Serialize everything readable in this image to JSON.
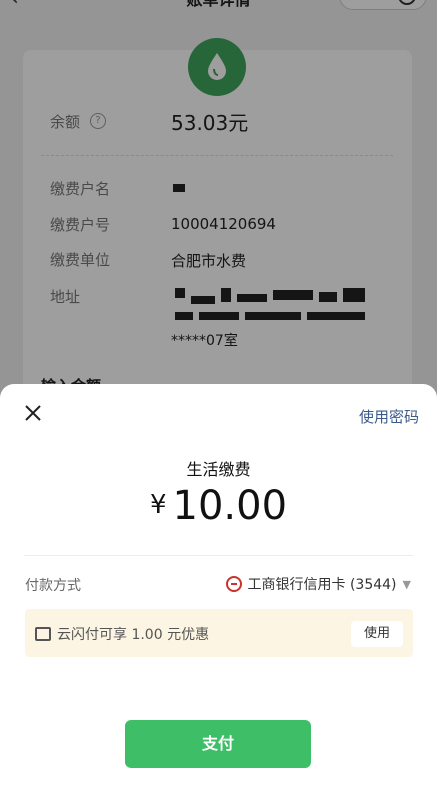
{
  "topbar": {
    "title": "账单详情",
    "back_icon": "chevron-left-icon"
  },
  "card": {
    "balance_label": "余额",
    "balance_value": "53.03元",
    "account_name_label": "缴费户名",
    "account_no_label": "缴费户号",
    "account_no_value": "10004120694",
    "unit_label": "缴费单位",
    "unit_value": "合肥市水费",
    "address_label": "地址",
    "address_suffix": "*****07室",
    "input_amount_label": "输入金额"
  },
  "sheet": {
    "use_password": "使用密码",
    "merchant": "生活缴费",
    "currency": "¥",
    "amount": "10.00",
    "payment_method_label": "付款方式",
    "payment_method_value": "工商银行信用卡 (3544)",
    "promo_text": "云闪付可享 1.00 元优惠",
    "promo_button": "使用",
    "pay_button": "支付"
  },
  "colors": {
    "accent_green": "#3ebf67",
    "promo_bg": "#fdf5e3",
    "link_blue": "#3a5a8a"
  }
}
